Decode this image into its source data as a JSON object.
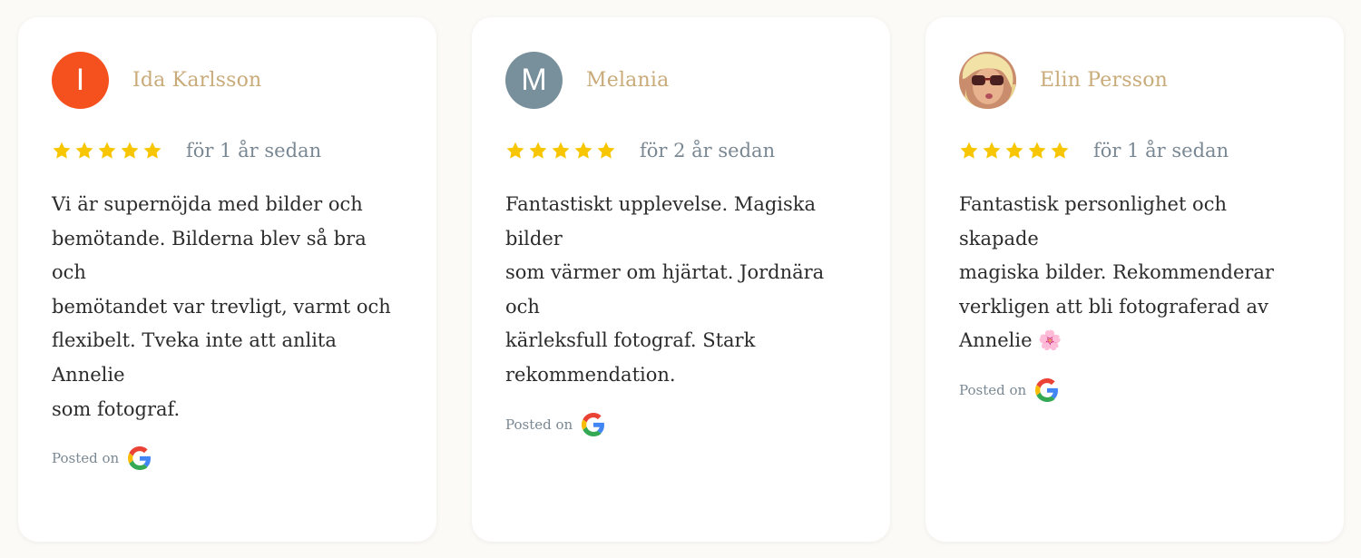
{
  "colors": {
    "page_background": "#fbfaf6",
    "card_background": "#ffffff",
    "name": "#c9ab7a",
    "star": "#f7c600",
    "meta_text": "#7a8893",
    "body_text": "#2c2c2c"
  },
  "reviews": [
    {
      "avatar_initial": "I",
      "avatar_color": "#f4511e",
      "name": "Ida Karlsson",
      "stars": 5,
      "time": "för 1 år sedan",
      "text": "Vi är supernöjda med bilder och\nbemötande. Bilderna blev så bra och\nbemötandet var trevligt, varmt och\nflexibelt. Tveka inte att anlita Annelie\nsom fotograf.",
      "posted_label": "Posted on",
      "source_icon": "google-g-icon"
    },
    {
      "avatar_initial": "M",
      "avatar_color": "#78909c",
      "name": "Melania",
      "stars": 5,
      "time": "för 2 år sedan",
      "text": "Fantastiskt upplevelse. Magiska bilder\nsom värmer om hjärtat. Jordnära och\nkärleksfull fotograf. Stark\nrekommendation.",
      "posted_label": "Posted on",
      "source_icon": "google-g-icon"
    },
    {
      "avatar_icon": "profile-photo",
      "name": "Elin Persson",
      "stars": 5,
      "time": "för 1 år sedan",
      "text": "Fantastisk personlighet och skapade\nmagiska bilder. Rekommenderar\nverkligen att bli fotograferad av\nAnnelie 🌸",
      "posted_label": "Posted on",
      "source_icon": "google-g-icon"
    }
  ]
}
